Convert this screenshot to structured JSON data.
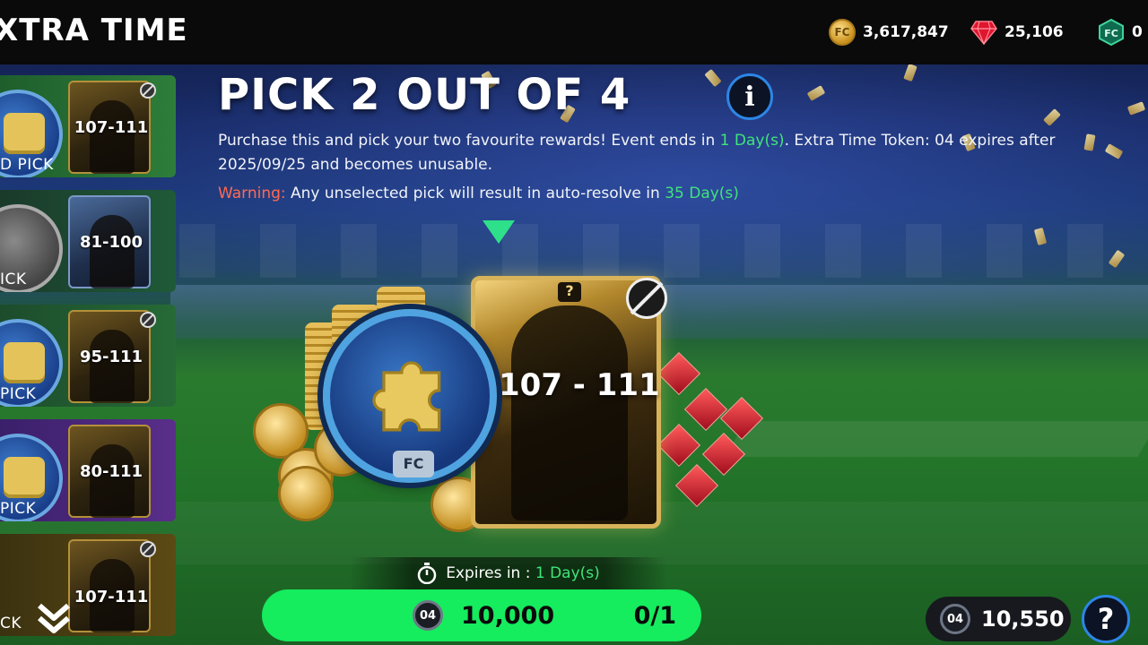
{
  "header": {
    "title": "XTRA TIME",
    "currencies": [
      {
        "icon": "fc-coin-icon",
        "value": "3,617,847"
      },
      {
        "icon": "fc-points-gem-icon",
        "value": "25,106"
      },
      {
        "icon": "fc-token-icon",
        "value": "0"
      }
    ]
  },
  "sidebar": {
    "items": [
      {
        "range": "107-111",
        "tag": "D PICK"
      },
      {
        "range": "81-100",
        "tag": "ICK"
      },
      {
        "range": "95-111",
        "tag": "PICK"
      },
      {
        "range": "80-111",
        "tag": "PICK"
      },
      {
        "range": "107-111",
        "tag": "CK"
      }
    ]
  },
  "offer": {
    "headline": "PICK 2 OUT OF 4",
    "desc_1": "Purchase this and pick your two favourite rewards! Event ends in ",
    "desc_days": "1 Day(s)",
    "desc_2": ". Extra Time Token: 04 expires after 2025/09/25 and becomes unusable.",
    "warning_label": "Warning:",
    "warning_text": " Any unselected pick will result in auto-resolve in ",
    "warning_days": "35 Day(s)",
    "card_range": "107 - 111",
    "card_badge": "?",
    "medal_badge": "FC",
    "expiry_label": "Expires in : ",
    "expiry_value": "1 Day(s)"
  },
  "purchase": {
    "token_label": "04",
    "price": "10,000",
    "count": "0/1"
  },
  "footer": {
    "token_label": "04",
    "balance": "10,550",
    "help": "?"
  },
  "colors": {
    "accent_green": "#15ec5e",
    "highlight_green": "#3fe47a",
    "warning_red": "#ff6a52",
    "info_blue": "#2c86e6"
  }
}
